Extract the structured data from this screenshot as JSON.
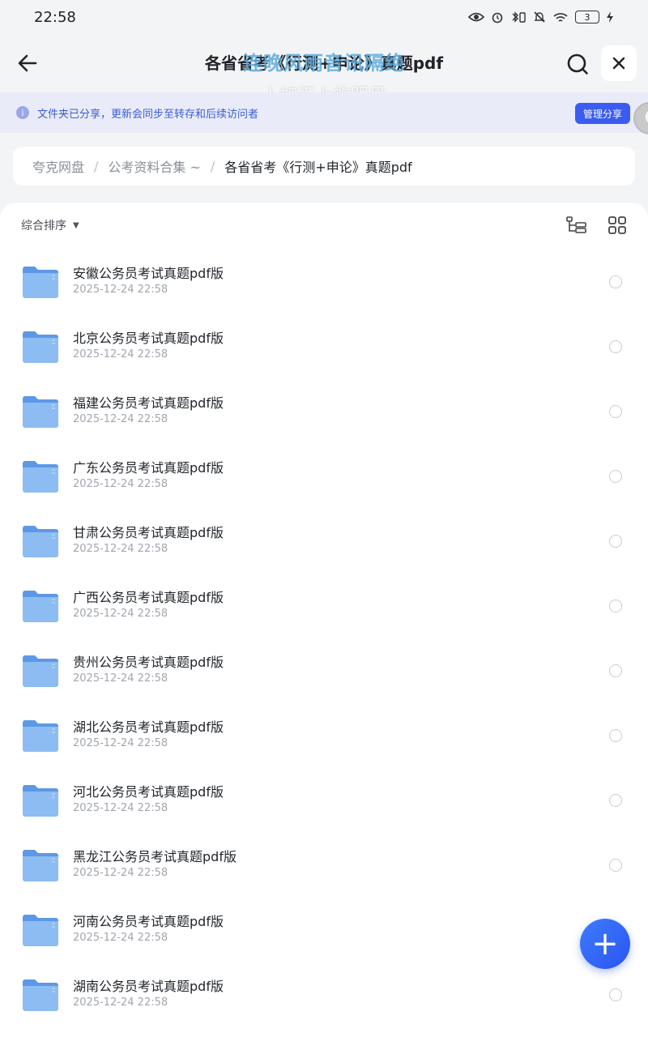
{
  "status_bar": {
    "time": "22:58",
    "battery": "3"
  },
  "header": {
    "title": "各省省考《行测+申论》真题pdf"
  },
  "overlay": {
    "lyric_line": "连晚风雨音讯隔绝",
    "lyric_sub": "人如天上的明月"
  },
  "share_banner": {
    "info_icon": "i",
    "text": "文件夹已分享，更新会同步至转存和后续访问者",
    "manage_label": "管理分享"
  },
  "breadcrumb": {
    "items": [
      "夸克网盘",
      "公考资料合集 ~",
      "各省省考《行测+申论》真题pdf"
    ],
    "separator": "/"
  },
  "toolbar": {
    "sort_label": "综合排序",
    "sort_caret": "▼"
  },
  "files": [
    {
      "name": "安徽公务员考试真题pdf版",
      "date": "2025-12-24 22:58"
    },
    {
      "name": "北京公务员考试真题pdf版",
      "date": "2025-12-24 22:58"
    },
    {
      "name": "福建公务员考试真题pdf版",
      "date": "2025-12-24 22:58"
    },
    {
      "name": "广东公务员考试真题pdf版",
      "date": "2025-12-24 22:58"
    },
    {
      "name": "甘肃公务员考试真题pdf版",
      "date": "2025-12-24 22:58"
    },
    {
      "name": "广西公务员考试真题pdf版",
      "date": "2025-12-24 22:58"
    },
    {
      "name": "贵州公务员考试真题pdf版",
      "date": "2025-12-24 22:58"
    },
    {
      "name": "湖北公务员考试真题pdf版",
      "date": "2025-12-24 22:58"
    },
    {
      "name": "河北公务员考试真题pdf版",
      "date": "2025-12-24 22:58"
    },
    {
      "name": "黑龙江公务员考试真题pdf版",
      "date": "2025-12-24 22:58"
    },
    {
      "name": "河南公务员考试真题pdf版",
      "date": "2025-12-24 22:58"
    },
    {
      "name": "湖南公务员考试真题pdf版",
      "date": "2025-12-24 22:58"
    }
  ],
  "fab": {
    "symbol": "+"
  },
  "colors": {
    "accent": "#3b5cf0",
    "banner_bg": "#e9ecf8",
    "folder": "#7fb2ef"
  }
}
